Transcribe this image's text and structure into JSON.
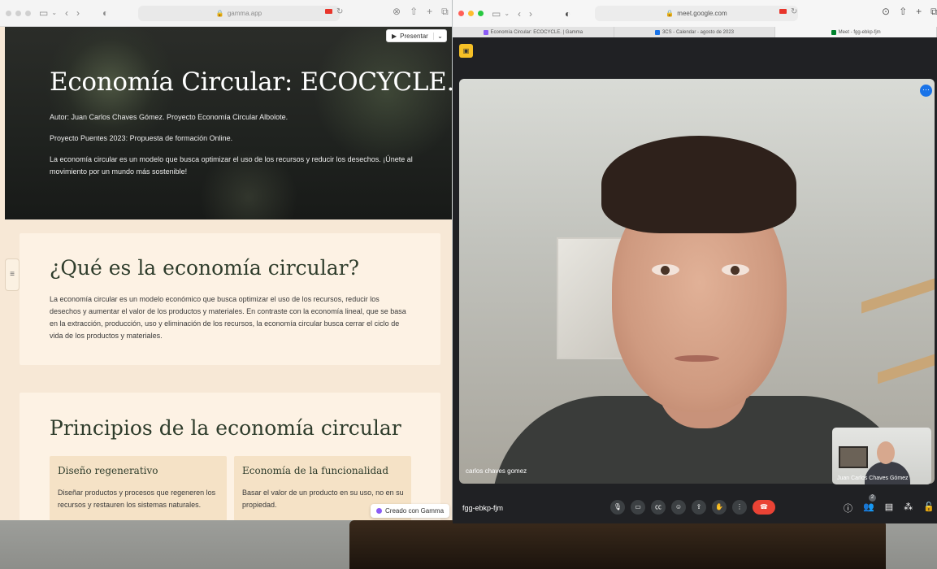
{
  "left_window": {
    "url": "gamma.app",
    "present_button": "Presentar",
    "hero": {
      "title": "Economía Circular: ECOCYCLE.",
      "author": "Autor: Juan Carlos Chaves Gómez. Proyecto Economía Circular Albolote.",
      "project": "Proyecto Puentes 2023: Propuesta de formación Online.",
      "description": "La economía circular es un modelo que busca optimizar el uso de los recursos y reducir los desechos. ¡Únete al movimiento por un mundo más sostenible!"
    },
    "section1": {
      "heading": "¿Qué es la economía circular?",
      "body": "La economía circular es un modelo económico que busca optimizar el uso de los recursos, reducir los desechos y aumentar el valor de los productos y materiales. En contraste con la economía lineal, que se basa en la extracción, producción, uso y eliminación de los recursos, la economía circular busca cerrar el ciclo de vida de los productos y materiales."
    },
    "section2": {
      "heading": "Principios de la economía circular",
      "cards": [
        {
          "title": "Diseño regenerativo",
          "body": "Diseñar productos y procesos que regeneren los recursos y restauren los sistemas naturales."
        },
        {
          "title": "Economía de la funcionalidad",
          "body": "Basar el valor de un producto en su uso, no en su propiedad."
        }
      ]
    },
    "badge": "Creado con Gamma",
    "menu_icon": "≡"
  },
  "right_window": {
    "url": "meet.google.com",
    "tabs": [
      {
        "label": "Economía Circular: ECOCYCLE. | Gamma",
        "icon_color": "#8b5cf6"
      },
      {
        "label": "3CS - Calendar - agosto de 2023",
        "icon_color": "#1a73e8"
      },
      {
        "label": "Meet - fgg-ebkp-fjm",
        "icon_color": "#00832d"
      }
    ],
    "main_participant": "carlos chaves gomez",
    "pip_participant": "Juan Carlos Chaves Gómez",
    "meeting_code": "fgg-ebkp-fjm",
    "people_count": "2"
  },
  "colors": {
    "accent_meet_end": "#ea4335",
    "meet_bg": "#202124",
    "gamma_bg": "#f7e8d6"
  }
}
